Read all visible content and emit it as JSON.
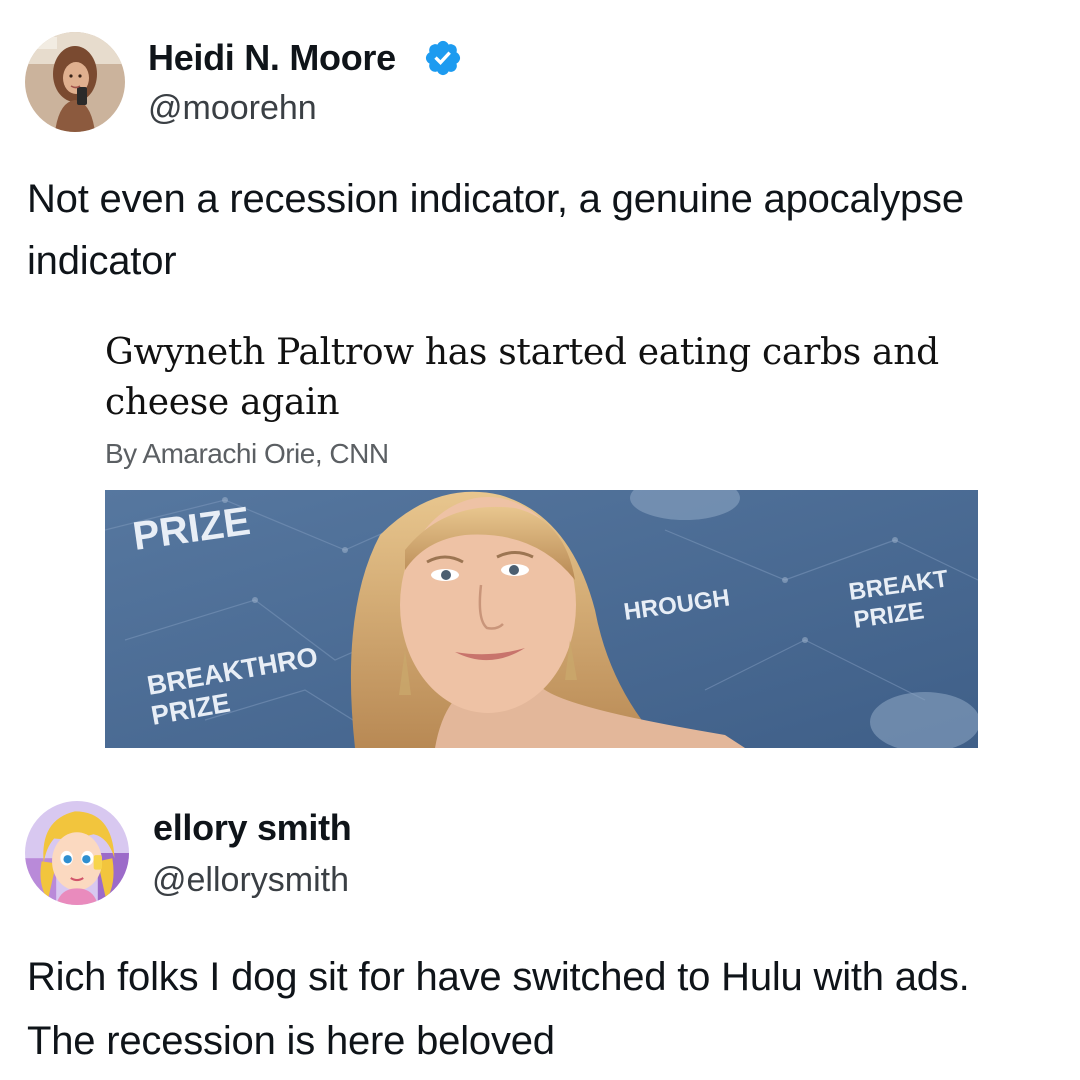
{
  "tweets": [
    {
      "author_name": "Heidi N. Moore",
      "handle": "@moorehn",
      "verified": true,
      "verified_icon": "verified-badge-icon",
      "text": "Not even a recession indicator, a genuine apocalypse indicator",
      "quoted_article": {
        "headline": "Gwyneth Paltrow has started eating carbs and cheese again",
        "byline": "By Amarachi Orie, CNN",
        "photo_backdrop_text": [
          "PRIZE",
          "BREAKTHRO",
          "PRIZE",
          "HROUGH",
          "BREAKT",
          "PRIZE"
        ]
      }
    },
    {
      "author_name": "ellory smith",
      "handle": "@ellorysmith",
      "verified": false,
      "text": "Rich folks I dog sit for have switched to Hulu with ads. The recession is here beloved"
    }
  ],
  "colors": {
    "verified_blue": "#1d9bf0",
    "text_primary": "#0f1419",
    "text_secondary": "#536471",
    "backdrop_blue": "#4d6e96"
  }
}
